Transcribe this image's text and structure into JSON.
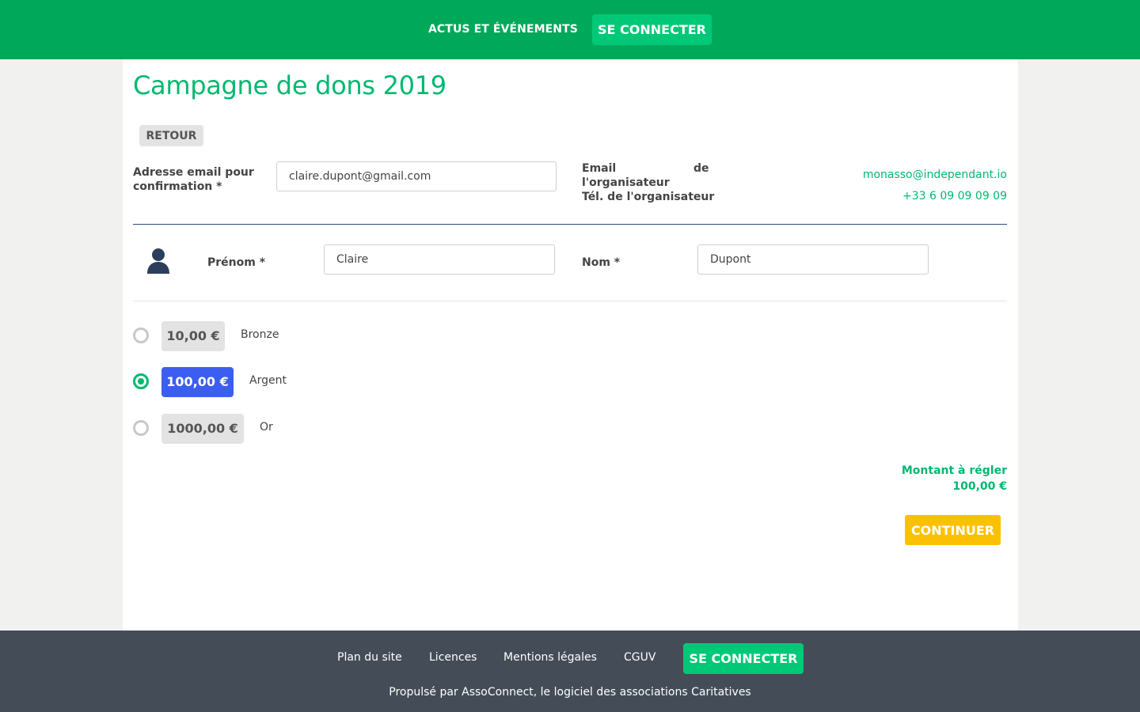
{
  "header": {
    "nav_news": "ACTUS ET ÉVÉNEMENTS",
    "login": "SE CONNECTER"
  },
  "page": {
    "title": "Campagne de dons 2019",
    "back": "RETOUR"
  },
  "form": {
    "email_label_line1": "Adresse email pour",
    "email_label_line2": "confirmation *",
    "email_value": "claire.dupont@gmail.com",
    "org_email_label_a": "Email",
    "org_email_label_b": "de",
    "org_email_label_c": "l'organisateur",
    "org_email_value": "monasso@independant.io",
    "org_phone_label": "Tél. de l'organisateur",
    "org_phone_value": "+33 6 09 09 09 09",
    "firstname_label": "Prénom *",
    "firstname_value": "Claire",
    "lastname_label": "Nom *",
    "lastname_value": "Dupont"
  },
  "options": [
    {
      "amount": "10,00 €",
      "name": "Bronze",
      "selected": false
    },
    {
      "amount": "100,00 €",
      "name": "Argent",
      "selected": true
    },
    {
      "amount": "1000,00 €",
      "name": "Or",
      "selected": false
    }
  ],
  "total": {
    "label": "Montant à régler",
    "value": "100,00 €"
  },
  "continue": "CONTINUER",
  "footer": {
    "sitemap": "Plan du site",
    "licenses": "Licences",
    "legal": "Mentions légales",
    "cguv": "CGUV",
    "login": "SE CONNECTER",
    "powered": "Propulsé par AssoConnect, le logiciel des associations Caritatives"
  },
  "colors": {
    "brand_green": "#00a85a",
    "accent_green": "#00b870",
    "selected_blue": "#3b5ef0",
    "continue_yellow": "#fbc100",
    "footer_bg": "#434c57"
  }
}
